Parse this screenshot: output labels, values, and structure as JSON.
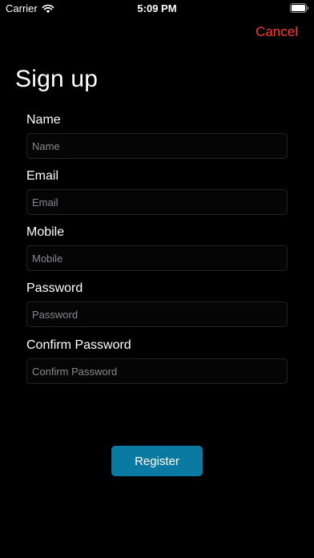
{
  "status_bar": {
    "carrier": "Carrier",
    "time": "5:09 PM"
  },
  "nav": {
    "cancel_label": "Cancel",
    "cancel_color": "#ff3b30"
  },
  "page": {
    "title": "Sign up"
  },
  "form": {
    "fields": [
      {
        "label": "Name",
        "placeholder": "Name",
        "value": ""
      },
      {
        "label": "Email",
        "placeholder": "Email",
        "value": ""
      },
      {
        "label": "Mobile",
        "placeholder": "Mobile",
        "value": ""
      },
      {
        "label": "Password",
        "placeholder": "Password",
        "value": ""
      },
      {
        "label": "Confirm Password",
        "placeholder": "Confirm Password",
        "value": ""
      }
    ],
    "submit_label": "Register",
    "submit_color": "#0b7aa3"
  },
  "icons": {
    "wifi": "wifi-icon",
    "battery": "battery-icon"
  }
}
